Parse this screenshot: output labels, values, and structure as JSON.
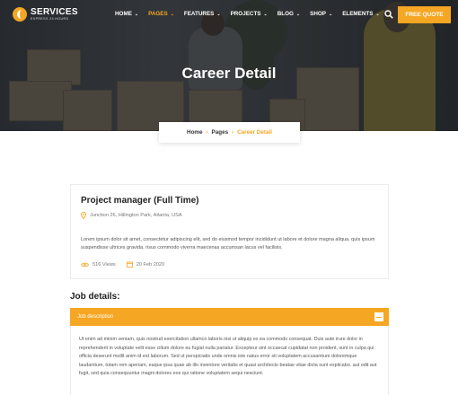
{
  "header": {
    "logo_title": "SERVICES",
    "logo_subtitle": "EXPRESS 24 HOURS",
    "nav": [
      {
        "label": "HOME",
        "active": false
      },
      {
        "label": "PAGES",
        "active": true
      },
      {
        "label": "FEATURES",
        "active": false
      },
      {
        "label": "PROJECTS",
        "active": false
      },
      {
        "label": "BLOG",
        "active": false
      },
      {
        "label": "SHOP",
        "active": false
      },
      {
        "label": "ELEMENTS",
        "active": false
      }
    ],
    "search_icon": "search-icon",
    "cta_label": "FREE QUOTE"
  },
  "hero": {
    "title": "Career Detail"
  },
  "breadcrumb": {
    "items": [
      "Home",
      "Pages",
      "Career Detail"
    ]
  },
  "job": {
    "title": "Project manager (Full Time)",
    "location": "Junction 26,  Hillington Park,  Atlanta, USA",
    "description": "Lorem ipsum dolor sit amet, consectetur adipiscing elit, sed do eiusmod tempor incididunt ut labore et dolore magna aliqua. quis ipsum suspendisse ultrices gravida. risus commodo viverra maecenas accumsan lacus vel facilisis.",
    "views": "516 Views",
    "date": "20 Feb 2020"
  },
  "details": {
    "heading": "Job details:",
    "accordion_title": "Job description",
    "accordion_text": "Ut enim ad minim veniam, quis nostrud exercitation ullamco laboris nisi ut aliquip ex ea commodo consequat. Duis aute irure dolor in reprehenderit in voluptate velit esse cillum dolore eu fugiat nulla pariatur. Excepteur sint occaecat cupidatat non proident, sunt in culpa qui officia deserunt mollit anim id est laborum. Sed ut perspiciatis unde omnis iste natus error sit voluptatem accusantium doloremque laudantium, totam rem aperiam, eaque ipsa quae ab illo inventore veritatis et quasi architecto beatae vitae dicta sunt explicabo. aut odit aut fugit, sed quia consequuntur magni dolores eos qui ratione voluptatem sequi nesciunt."
  },
  "colors": {
    "accent": "#f5a623",
    "text_dark": "#222222",
    "text_muted": "#777777"
  }
}
